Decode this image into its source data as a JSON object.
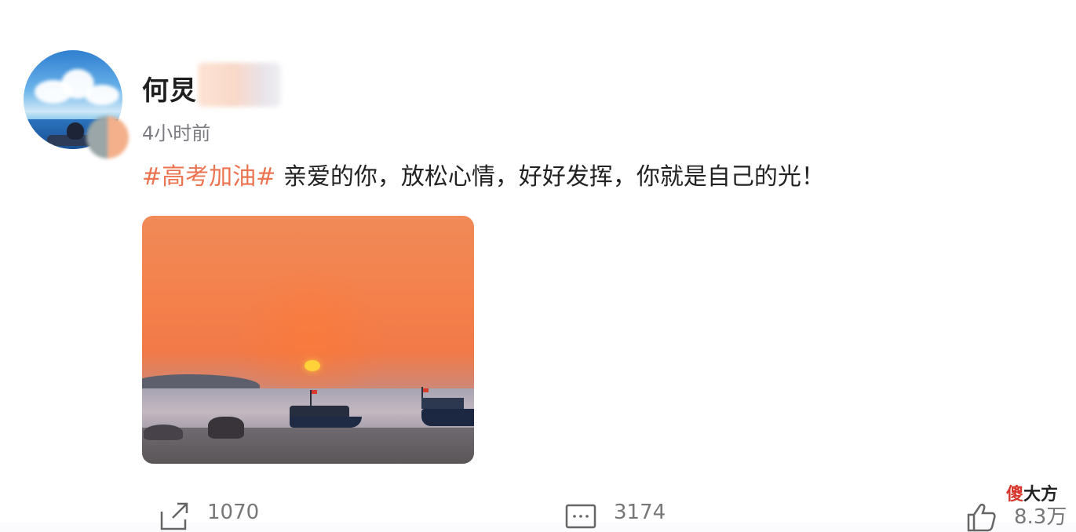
{
  "post": {
    "username": "何炅",
    "timestamp": "4小时前",
    "hashtag": "#高考加油#",
    "text": " 亲爱的你，放松心情，好好发挥，你就是自己的光！"
  },
  "actions": {
    "repost_count": "1070",
    "comment_count": "3174",
    "like_count": "8.3万"
  },
  "watermark": {
    "first": "傻",
    "rest": "大方"
  },
  "colors": {
    "hashtag": "#eb7350",
    "text": "#222222",
    "muted": "#7a7a80"
  },
  "icons": [
    "repost-icon",
    "comment-icon",
    "like-icon"
  ]
}
